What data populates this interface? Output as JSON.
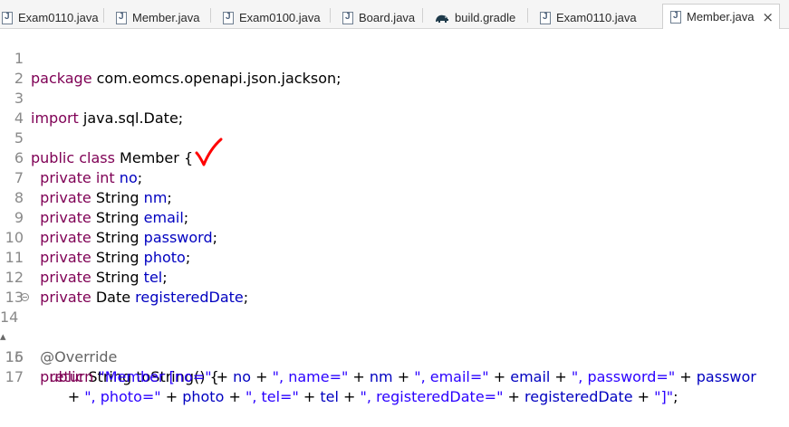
{
  "tabs": [
    {
      "label": "Exam0110.java",
      "icon": "java-file-icon"
    },
    {
      "label": "Member.java",
      "icon": "java-file-icon"
    },
    {
      "label": "Exam0100.java",
      "icon": "java-file-icon"
    },
    {
      "label": "Board.java",
      "icon": "java-file-icon"
    },
    {
      "label": "build.gradle",
      "icon": "gradle-icon"
    },
    {
      "label": "Exam0110.java",
      "icon": "java-file-icon"
    },
    {
      "label": "Member.java",
      "icon": "java-file-icon",
      "active": true,
      "close": "×"
    }
  ],
  "colors": {
    "keyword": "#7f0055",
    "field": "#0000c0",
    "string": "#2a00ff",
    "annotation": "#646464",
    "check_mark": "#ff0000"
  },
  "lines": [
    {
      "n": "1",
      "t1": "package",
      "t2": " com.eomcs.openapi.json.jackson;"
    },
    {
      "n": "2"
    },
    {
      "n": "3",
      "t1": "import",
      "t2": " java.sql.Date;"
    },
    {
      "n": "4"
    },
    {
      "n": "5",
      "t1": "public",
      "t2": " ",
      "t3": "class",
      "t4": " Member {"
    },
    {
      "n": "6",
      "t1": "  private",
      "t2": " ",
      "t3": "int",
      "t4": " ",
      "t5": "no",
      "t6": ";"
    },
    {
      "n": "7",
      "t1": "  private",
      "t2": " String ",
      "t3": "nm",
      "t4": ";"
    },
    {
      "n": "8",
      "t1": "  private",
      "t2": " String ",
      "t3": "email",
      "t4": ";"
    },
    {
      "n": "9",
      "t1": "  private",
      "t2": " String ",
      "t3": "password",
      "t4": ";"
    },
    {
      "n": "10",
      "t1": "  private",
      "t2": " String ",
      "t3": "photo",
      "t4": ";"
    },
    {
      "n": "11",
      "t1": "  private",
      "t2": " String ",
      "t3": "tel",
      "t4": ";"
    },
    {
      "n": "12",
      "t1": "  private",
      "t2": " Date ",
      "t3": "registeredDate",
      "t4": ";"
    },
    {
      "n": "13"
    },
    {
      "n": "14",
      "t1": "  @Override"
    },
    {
      "n": "15",
      "t1": "  public",
      "t2": " String toString() {"
    },
    {
      "n": "16",
      "t1": "    return",
      "t2": " ",
      "s1": "\"Member [no=\"",
      "p1": " + ",
      "f1": "no",
      "p2": " + ",
      "s2": "\", name=\"",
      "p3": " + ",
      "f2": "nm",
      "p4": " + ",
      "s3": "\", email=\"",
      "p5": " + ",
      "f3": "email",
      "p6": " + ",
      "s4": "\", password=\"",
      "p7": " + ",
      "f4": "passwor"
    },
    {
      "n": "17",
      "p0": "        + ",
      "s1": "\", photo=\"",
      "p1": " + ",
      "f1": "photo",
      "p2": " + ",
      "s2": "\", tel=\"",
      "p3": " + ",
      "f2": "tel",
      "p4": " + ",
      "s3": "\", registeredDate=\"",
      "p5": " + ",
      "f3": "registeredDate",
      "p6": " + ",
      "s4": "\"]\"",
      "p7": ";"
    }
  ]
}
